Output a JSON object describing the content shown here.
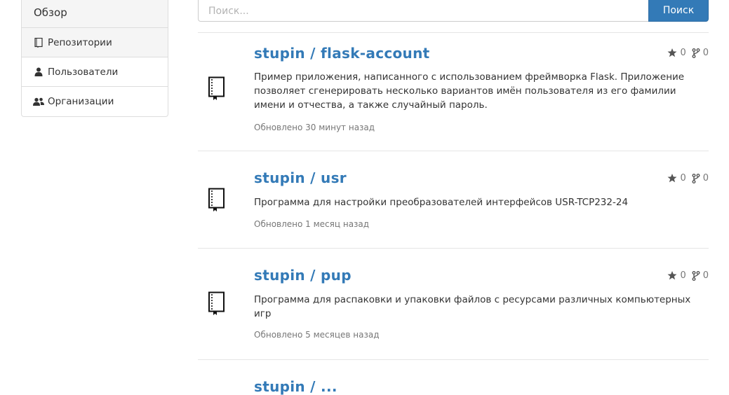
{
  "sidebar": {
    "header": "Обзор",
    "items": [
      {
        "label": "Репозитории",
        "icon": "book-icon",
        "active": true
      },
      {
        "label": "Пользователи",
        "icon": "user-icon",
        "active": false
      },
      {
        "label": "Организации",
        "icon": "users-icon",
        "active": false
      }
    ]
  },
  "search": {
    "placeholder": "Поиск...",
    "button_label": "Поиск"
  },
  "repos": [
    {
      "title": "stupin / flask-account",
      "stars": "0",
      "forks": "0",
      "description": "Пример приложения, написанного с использованием фреймворка Flask. Приложение позволяет сгенерировать несколько вариантов имён пользователя из его фамилии имени и отчества, а также случайный пароль.",
      "updated": "Обновлено 30 минут назад"
    },
    {
      "title": "stupin / usr",
      "stars": "0",
      "forks": "0",
      "description": "Программа для настройки преобразователей интерфейсов USR-TCP232-24",
      "updated": "Обновлено 1 месяц назад"
    },
    {
      "title": "stupin / pup",
      "stars": "0",
      "forks": "0",
      "description": "Программа для распаковки и упаковки файлов с ресурсами различных компьютерных игр",
      "updated": "Обновлено 5 месяцев назад"
    },
    {
      "title": "stupin / ...",
      "stars": "",
      "forks": "",
      "description": "",
      "updated": ""
    }
  ],
  "colors": {
    "link": "#337ab7",
    "muted": "#777777",
    "border": "#e5e5e5",
    "active_bg": "#f5f5f5"
  }
}
